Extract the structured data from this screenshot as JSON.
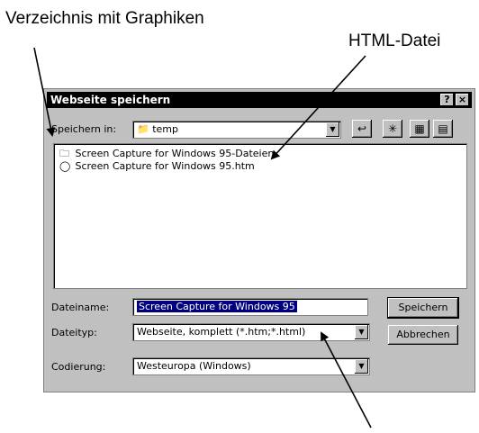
{
  "annotations": {
    "folder_label": "Verzeichnis mit Graphiken",
    "html_file_label": "HTML-Datei"
  },
  "dialog": {
    "title": "Webseite speichern",
    "help_btn": "?",
    "close_btn": "×",
    "save_in_label": "Speichern in:",
    "save_in_value": "temp",
    "files": [
      {
        "name": "Screen Capture for Windows 95-Dateien",
        "icon": "folder-icon"
      },
      {
        "name": "Screen Capture for Windows 95.htm",
        "icon": "html-document-icon"
      }
    ],
    "filename_label": "Dateiname:",
    "filename_value": "Screen Capture for Windows 95",
    "filetype_label": "Dateityp:",
    "filetype_value": "Webseite, komplett (*.htm;*.html)",
    "encoding_label": "Codierung:",
    "encoding_value": "Westeuropa (Windows)",
    "save_button": "Speichern",
    "cancel_button": "Abbrechen"
  }
}
